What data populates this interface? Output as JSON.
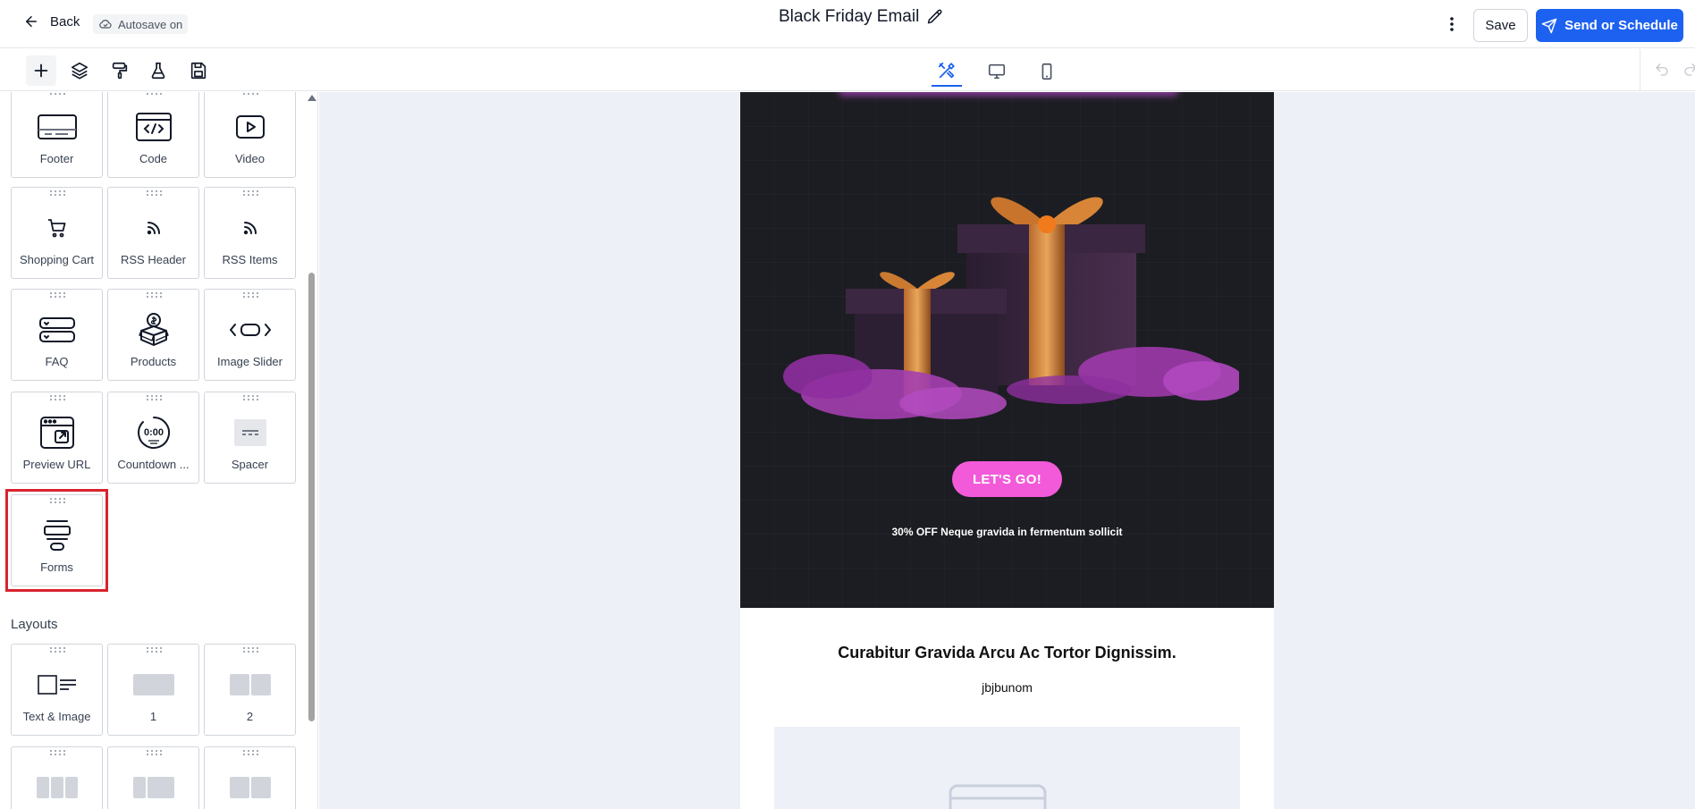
{
  "header": {
    "back_label": "Back",
    "autosave_label": "Autosave on",
    "title": "Black Friday Email",
    "save_label": "Save",
    "send_label": "Send or Schedule",
    "accent_color": "#1d61f0"
  },
  "toolbar": {
    "left_tools": [
      "plus-icon",
      "layers-icon",
      "paint-roller-icon",
      "flask-icon",
      "save-disk-icon"
    ],
    "view_tabs": [
      "builder-tools-icon",
      "desktop-icon",
      "mobile-icon"
    ],
    "active_view": "builder-tools-icon"
  },
  "sidebar": {
    "elements": [
      {
        "label": "Footer",
        "icon": "footer-icon"
      },
      {
        "label": "Code",
        "icon": "code-icon"
      },
      {
        "label": "Video",
        "icon": "video-icon"
      },
      {
        "label": "Shopping Cart",
        "icon": "cart-icon"
      },
      {
        "label": "RSS Header",
        "icon": "rss-icon"
      },
      {
        "label": "RSS Items",
        "icon": "rss-icon"
      },
      {
        "label": "FAQ",
        "icon": "faq-icon"
      },
      {
        "label": "Products",
        "icon": "products-icon"
      },
      {
        "label": "Image Slider",
        "icon": "slider-icon"
      },
      {
        "label": "Preview URL",
        "icon": "preview-url-icon"
      },
      {
        "label": "Countdown ...",
        "icon": "countdown-icon"
      },
      {
        "label": "Spacer",
        "icon": "spacer-icon"
      },
      {
        "label": "Forms",
        "icon": "forms-icon",
        "highlighted": true
      }
    ],
    "countdown_icon_text": "0:00",
    "layouts_title": "Layouts",
    "layouts": [
      {
        "label": "Text & Image",
        "icon": "text-image-layout-icon"
      },
      {
        "label": "1",
        "icon": "one-column-icon"
      },
      {
        "label": "2",
        "icon": "two-column-icon"
      }
    ],
    "highlight_color": "#d9232e"
  },
  "email": {
    "cta_label": "LET'S GO!",
    "promo_text": "30% OFF Neque gravida in fermentum sollicit",
    "heading": "Curabitur Gravida Arcu Ac Tortor Dignissim.",
    "subtext": "jbjbunom",
    "cta_color": "#f25ad9",
    "hero_bg": "#1c1d22"
  }
}
